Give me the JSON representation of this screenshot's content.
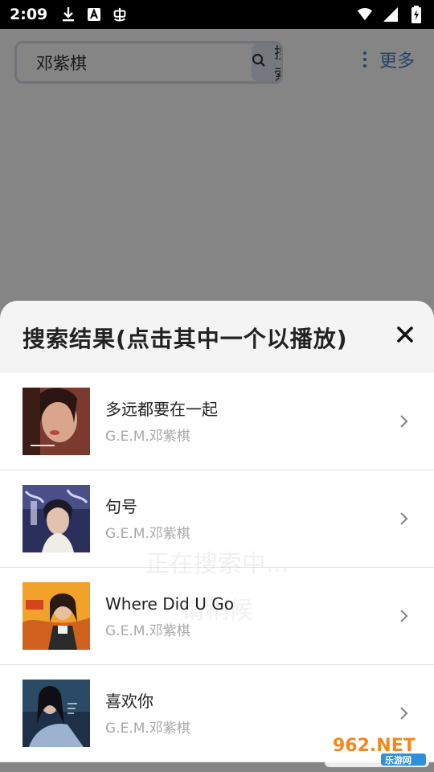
{
  "status_bar": {
    "time": "2:09",
    "left_icons": [
      "download-icon",
      "a-icon",
      "bug-icon"
    ],
    "right_icons": [
      "wifi-icon",
      "signal-icon",
      "battery-icon"
    ]
  },
  "search": {
    "value": "邓紫棋",
    "button_label": "搜索"
  },
  "header": {
    "more_label": "更多"
  },
  "loading": {
    "line1": "正在搜索中...",
    "line2": "请稍候"
  },
  "sheet": {
    "title": "搜索结果(点击其中一个以播放)",
    "items": [
      {
        "title": "多远都要在一起",
        "artist": "G.E.M.邓紫棋"
      },
      {
        "title": "句号",
        "artist": "G.E.M.邓紫棋"
      },
      {
        "title": "Where Did U Go",
        "artist": "G.E.M.邓紫棋"
      },
      {
        "title": "喜欢你",
        "artist": "G.E.M.邓紫棋"
      }
    ]
  },
  "watermark": {
    "text_top": "962.NET",
    "text_bottom": "乐游网"
  },
  "colors": {
    "accent": "#4a80c6",
    "scrim": "rgba(0,0,0,0.48)"
  }
}
